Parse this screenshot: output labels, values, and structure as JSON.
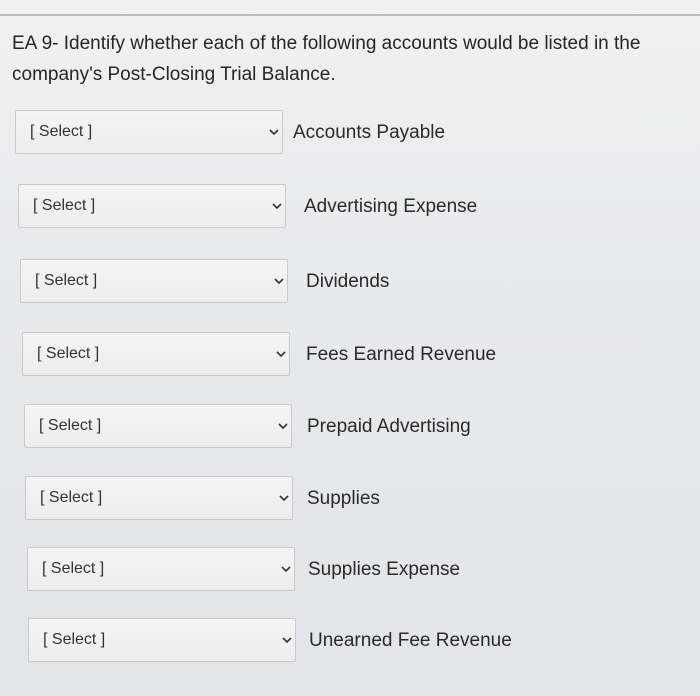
{
  "question": {
    "text": "EA 9- Identify whether each of the following accounts would be listed in the company's Post-Closing Trial Balance."
  },
  "rows": [
    {
      "select_value": "[ Select ]",
      "account": "Accounts Payable"
    },
    {
      "select_value": "[ Select ]",
      "account": "Advertising Expense"
    },
    {
      "select_value": "[ Select ]",
      "account": "Dividends"
    },
    {
      "select_value": "[ Select ]",
      "account": "Fees Earned Revenue"
    },
    {
      "select_value": "[ Select ]",
      "account": "Prepaid Advertising"
    },
    {
      "select_value": "[ Select ]",
      "account": "Supplies"
    },
    {
      "select_value": "[ Select ]",
      "account": "Supplies Expense"
    },
    {
      "select_value": "[ Select ]",
      "account": "Unearned Fee Revenue"
    }
  ],
  "icons": {
    "dropdown": "chevron-down-icon"
  }
}
